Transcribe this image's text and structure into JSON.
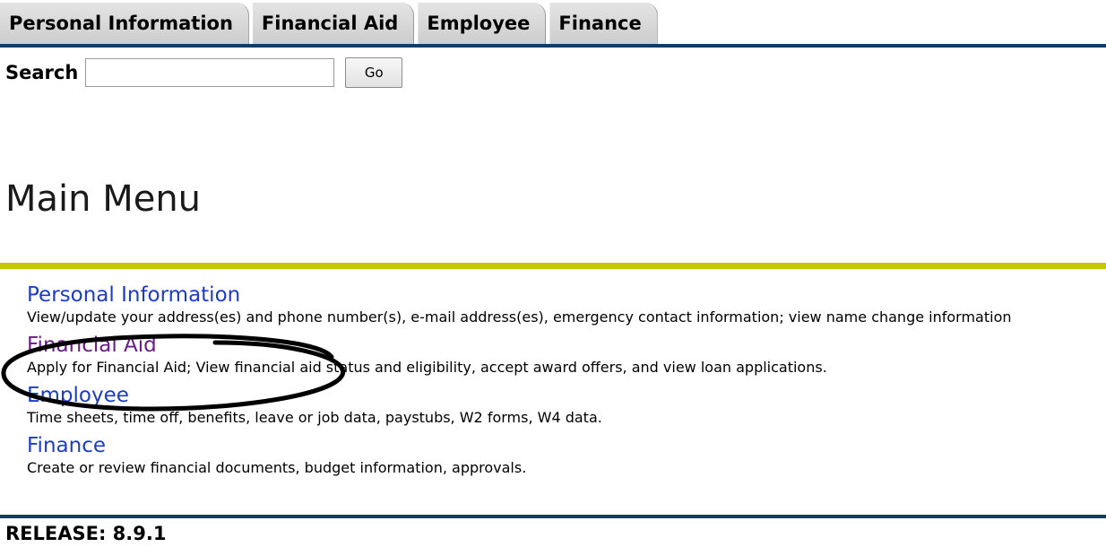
{
  "tabs": [
    {
      "label": "Personal Information"
    },
    {
      "label": "Financial Aid"
    },
    {
      "label": "Employee"
    },
    {
      "label": "Finance"
    }
  ],
  "search": {
    "label": "Search",
    "value": "",
    "placeholder": "",
    "go_label": "Go"
  },
  "page_title": "Main Menu",
  "menu": [
    {
      "title": "Personal Information",
      "description": "View/update your address(es) and phone number(s), e-mail address(es), emergency contact information; view name change information",
      "visited": false
    },
    {
      "title": "Financial Aid",
      "description": "Apply for Financial Aid; View financial aid status and eligibility, accept award offers, and view loan applications.",
      "visited": true
    },
    {
      "title": "Employee",
      "description": "Time sheets, time off, benefits, leave or job data, paystubs, W2 forms, W4 data.",
      "visited": false
    },
    {
      "title": "Finance",
      "description": "Create or review financial documents, budget information, approvals.",
      "visited": false
    }
  ],
  "release": "RELEASE: 8.9.1",
  "colors": {
    "tab_rule": "#153a63",
    "title_rule": "#c6c800",
    "link": "#1c3cc8",
    "visited_link": "#6a1c8a",
    "annotation": "#000000"
  },
  "annotation": {
    "shape": "hand-drawn-ellipse",
    "target": "menu item Financial Aid"
  }
}
